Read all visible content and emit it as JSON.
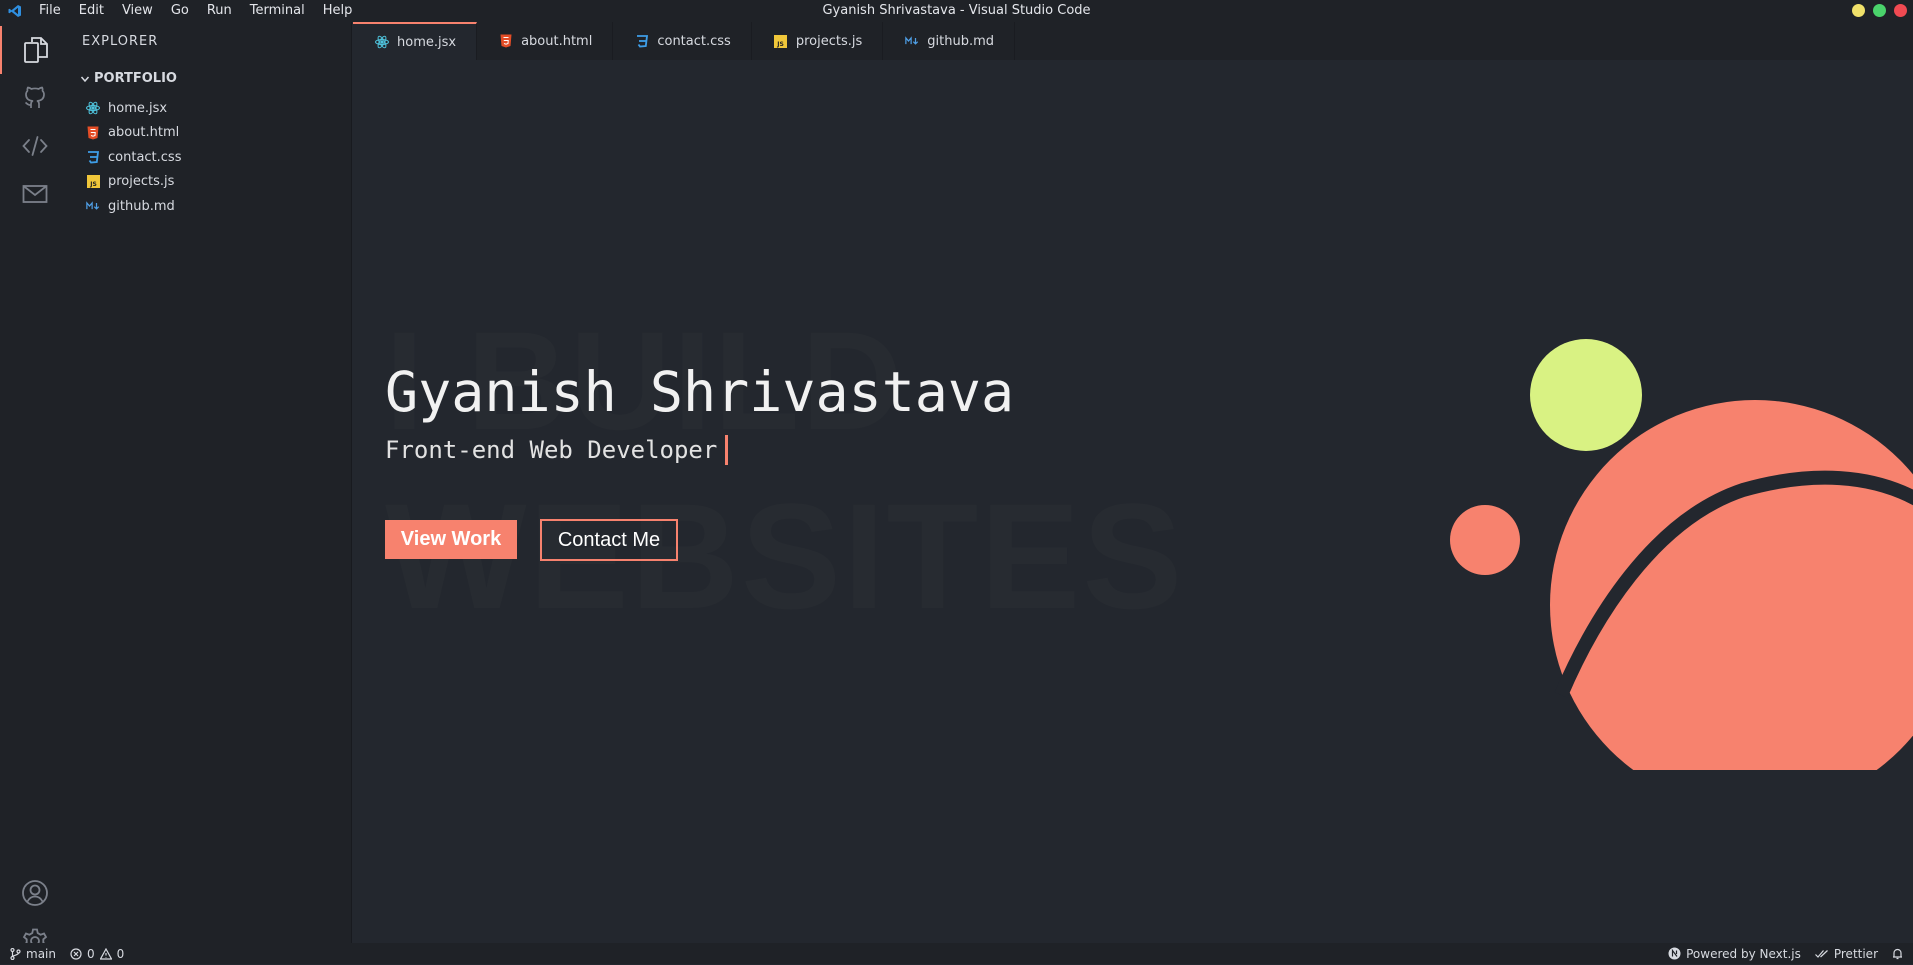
{
  "window": {
    "title": "Gyanish Shrivastava - Visual Studio Code",
    "menu": [
      "File",
      "Edit",
      "View",
      "Go",
      "Run",
      "Terminal",
      "Help"
    ]
  },
  "activity_bar": {
    "items": [
      "explorer-icon",
      "github-icon",
      "code-icon",
      "mail-icon"
    ],
    "bottom": [
      "account-icon",
      "gear-icon"
    ]
  },
  "explorer": {
    "title": "EXPLORER",
    "folder": "PORTFOLIO",
    "files": [
      {
        "name": "home.jsx",
        "icon": "react-icon"
      },
      {
        "name": "about.html",
        "icon": "html-icon"
      },
      {
        "name": "contact.css",
        "icon": "css-icon"
      },
      {
        "name": "projects.js",
        "icon": "js-icon"
      },
      {
        "name": "github.md",
        "icon": "markdown-icon"
      }
    ]
  },
  "tabs": [
    {
      "label": "home.jsx",
      "icon": "react-icon",
      "active": true
    },
    {
      "label": "about.html",
      "icon": "html-icon",
      "active": false
    },
    {
      "label": "contact.css",
      "icon": "css-icon",
      "active": false
    },
    {
      "label": "projects.js",
      "icon": "js-icon",
      "active": false
    },
    {
      "label": "github.md",
      "icon": "markdown-icon",
      "active": false
    }
  ],
  "hero": {
    "bg_word_1": "I BUILD",
    "bg_word_2": "WEBSITES",
    "name": "Gyanish Shrivastava",
    "role": "Front-end Web Developer",
    "view_work": "View Work",
    "contact_me": "Contact Me"
  },
  "status_bar": {
    "branch": "main",
    "errors": "0",
    "warnings": "0",
    "powered": "Powered by Next.js",
    "prettier": "Prettier"
  },
  "colors": {
    "accent": "#f7826e",
    "lime": "#d9f283",
    "editor_bg": "#23272e",
    "sidebar_bg": "#1f2227"
  }
}
